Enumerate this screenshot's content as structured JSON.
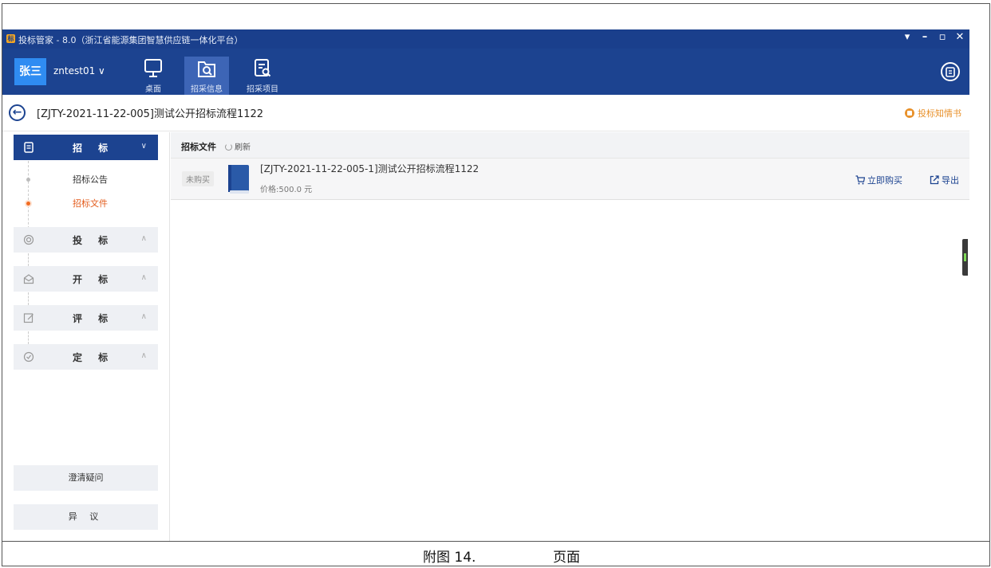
{
  "window": {
    "title": "投标管家 - 8.0（浙江省能源集团智慧供应链一体化平台）",
    "controls": [
      "▾",
      "–",
      "▫",
      "✕"
    ]
  },
  "user": {
    "avatar_text": "张三",
    "username": "zntest01 ∨"
  },
  "nav": {
    "items": [
      {
        "label": "桌面",
        "icon": "monitor-icon"
      },
      {
        "label": "招采信息",
        "icon": "search-folder-icon",
        "active": true
      },
      {
        "label": "招采项目",
        "icon": "project-list-icon"
      }
    ],
    "right_icon": "clipboard-icon"
  },
  "breadcrumb": {
    "back_symbol": "←",
    "title": "[ZJTY-2021-11-22-005]测试公开招标流程1122",
    "notice_link": "投标知情书"
  },
  "sidebar": {
    "groups": [
      {
        "label": "招 标",
        "chevron": "∨",
        "icon": "document-icon",
        "active": true
      },
      {
        "label": "投 标",
        "chevron": "∧",
        "icon": "target-icon"
      },
      {
        "label": "开 标",
        "chevron": "∧",
        "icon": "envelope-open-icon"
      },
      {
        "label": "评 标",
        "chevron": "∧",
        "icon": "edit-icon"
      },
      {
        "label": "定 标",
        "chevron": "∧",
        "icon": "check-circle-icon"
      }
    ],
    "subitems": [
      {
        "label": "招标公告"
      },
      {
        "label": "招标文件",
        "active": true
      }
    ],
    "buttons": [
      "澄清疑问",
      "异 议"
    ]
  },
  "main": {
    "header_title": "招标文件",
    "refresh_label": "刷新",
    "documents": [
      {
        "status": "未购买",
        "name": "[ZJTY-2021-11-22-005-1]测试公开招标流程1122",
        "price": "价格:500.0 元",
        "buy_label": "立即购买",
        "export_label": "导出"
      }
    ]
  },
  "caption": {
    "left": "附图 14.",
    "right": "页面"
  },
  "colors": {
    "primary": "#1c4390",
    "accent_orange": "#e8912b",
    "active_red": "#e35b1b",
    "avatar_blue": "#2f8cf2"
  }
}
